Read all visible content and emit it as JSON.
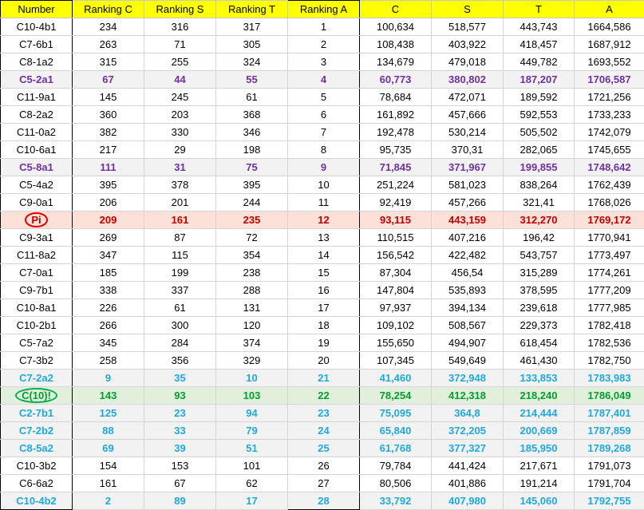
{
  "headers": [
    "Number",
    "Ranking C",
    "Ranking S",
    "Ranking T",
    "Ranking A",
    "C",
    "S",
    "T",
    "A"
  ],
  "rows": [
    {
      "cells": [
        "C10-4b1",
        "234",
        "316",
        "317",
        "1",
        "100,634",
        "518,577",
        "443,743",
        "1664,586"
      ],
      "style": "normal",
      "circled": false
    },
    {
      "cells": [
        "C7-6b1",
        "263",
        "71",
        "305",
        "2",
        "108,438",
        "403,922",
        "418,457",
        "1687,912"
      ],
      "style": "normal",
      "circled": false
    },
    {
      "cells": [
        "C8-1a2",
        "315",
        "255",
        "324",
        "3",
        "134,679",
        "479,018",
        "449,782",
        "1693,552"
      ],
      "style": "normal",
      "circled": false
    },
    {
      "cells": [
        "C5-2a1",
        "67",
        "44",
        "55",
        "4",
        "60,773",
        "380,802",
        "187,207",
        "1706,587"
      ],
      "style": "purple",
      "circled": false
    },
    {
      "cells": [
        "C11-9a1",
        "145",
        "245",
        "61",
        "5",
        "78,684",
        "472,071",
        "189,592",
        "1721,256"
      ],
      "style": "normal",
      "circled": false
    },
    {
      "cells": [
        "C8-2a2",
        "360",
        "203",
        "368",
        "6",
        "161,892",
        "457,666",
        "592,553",
        "1733,233"
      ],
      "style": "normal",
      "circled": false
    },
    {
      "cells": [
        "C11-0a2",
        "382",
        "330",
        "346",
        "7",
        "192,478",
        "530,214",
        "505,502",
        "1742,079"
      ],
      "style": "normal",
      "circled": false
    },
    {
      "cells": [
        "C10-6a1",
        "217",
        "29",
        "198",
        "8",
        "95,735",
        "370,31",
        "282,065",
        "1745,655"
      ],
      "style": "normal",
      "circled": false
    },
    {
      "cells": [
        "C5-8a1",
        "111",
        "31",
        "75",
        "9",
        "71,845",
        "371,967",
        "199,855",
        "1748,642"
      ],
      "style": "purple",
      "circled": false
    },
    {
      "cells": [
        "C5-4a2",
        "395",
        "378",
        "395",
        "10",
        "251,224",
        "581,023",
        "838,264",
        "1762,439"
      ],
      "style": "normal",
      "circled": false
    },
    {
      "cells": [
        "C9-0a1",
        "206",
        "201",
        "244",
        "11",
        "92,419",
        "457,266",
        "321,41",
        "1768,026"
      ],
      "style": "normal",
      "circled": false
    },
    {
      "cells": [
        "Pi",
        "209",
        "161",
        "235",
        "12",
        "93,115",
        "443,159",
        "312,270",
        "1769,172"
      ],
      "style": "red",
      "circled": true
    },
    {
      "cells": [
        "C9-3a1",
        "269",
        "87",
        "72",
        "13",
        "110,515",
        "407,216",
        "196,42",
        "1770,941"
      ],
      "style": "normal",
      "circled": false
    },
    {
      "cells": [
        "C11-8a2",
        "347",
        "115",
        "354",
        "14",
        "156,542",
        "422,482",
        "543,757",
        "1773,497"
      ],
      "style": "normal",
      "circled": false
    },
    {
      "cells": [
        "C7-0a1",
        "185",
        "199",
        "238",
        "15",
        "87,304",
        "456,54",
        "315,289",
        "1774,261"
      ],
      "style": "normal",
      "circled": false
    },
    {
      "cells": [
        "C9-7b1",
        "338",
        "337",
        "288",
        "16",
        "147,804",
        "535,893",
        "378,595",
        "1777,209"
      ],
      "style": "normal",
      "circled": false
    },
    {
      "cells": [
        "C10-8a1",
        "226",
        "61",
        "131",
        "17",
        "97,937",
        "394,134",
        "239,618",
        "1777,985"
      ],
      "style": "normal",
      "circled": false
    },
    {
      "cells": [
        "C10-2b1",
        "266",
        "300",
        "120",
        "18",
        "109,102",
        "508,567",
        "229,373",
        "1782,418"
      ],
      "style": "normal",
      "circled": false
    },
    {
      "cells": [
        "C5-7a2",
        "345",
        "284",
        "374",
        "19",
        "155,650",
        "494,907",
        "618,454",
        "1782,536"
      ],
      "style": "normal",
      "circled": false
    },
    {
      "cells": [
        "C7-3b2",
        "258",
        "356",
        "329",
        "20",
        "107,345",
        "549,649",
        "461,430",
        "1782,750"
      ],
      "style": "normal",
      "circled": false
    },
    {
      "cells": [
        "C7-2a2",
        "9",
        "35",
        "10",
        "21",
        "41,460",
        "372,948",
        "133,853",
        "1783,983"
      ],
      "style": "blue",
      "circled": false
    },
    {
      "cells": [
        "C(10)!",
        "143",
        "93",
        "103",
        "22",
        "78,254",
        "412,318",
        "218,240",
        "1786,049"
      ],
      "style": "green",
      "circled": true
    },
    {
      "cells": [
        "C2-7b1",
        "125",
        "23",
        "94",
        "23",
        "75,095",
        "364,8",
        "214,444",
        "1787,401"
      ],
      "style": "blue",
      "circled": false
    },
    {
      "cells": [
        "C7-2b2",
        "88",
        "33",
        "79",
        "24",
        "65,840",
        "372,205",
        "200,669",
        "1787,859"
      ],
      "style": "blue",
      "circled": false
    },
    {
      "cells": [
        "C8-5a2",
        "69",
        "39",
        "51",
        "25",
        "61,768",
        "377,327",
        "185,950",
        "1789,268"
      ],
      "style": "blue",
      "circled": false
    },
    {
      "cells": [
        "C10-3b2",
        "154",
        "153",
        "101",
        "26",
        "79,784",
        "441,424",
        "217,671",
        "1791,073"
      ],
      "style": "normal",
      "circled": false
    },
    {
      "cells": [
        "C6-6a2",
        "161",
        "67",
        "62",
        "27",
        "80,506",
        "401,886",
        "191,214",
        "1791,704"
      ],
      "style": "normal",
      "circled": false
    },
    {
      "cells": [
        "C10-4b2",
        "2",
        "89",
        "17",
        "28",
        "33,792",
        "407,980",
        "145,060",
        "1792,755"
      ],
      "style": "blue",
      "circled": false
    }
  ],
  "colors": {
    "header_bg": "#ffff00",
    "purple": "#7030a0",
    "red": "#c00000",
    "red_bg": "#fde0d8",
    "blue": "#1fa8e0",
    "green": "#00a030",
    "green_bg": "#e2efda",
    "band_bg": "#f2f2f2"
  }
}
